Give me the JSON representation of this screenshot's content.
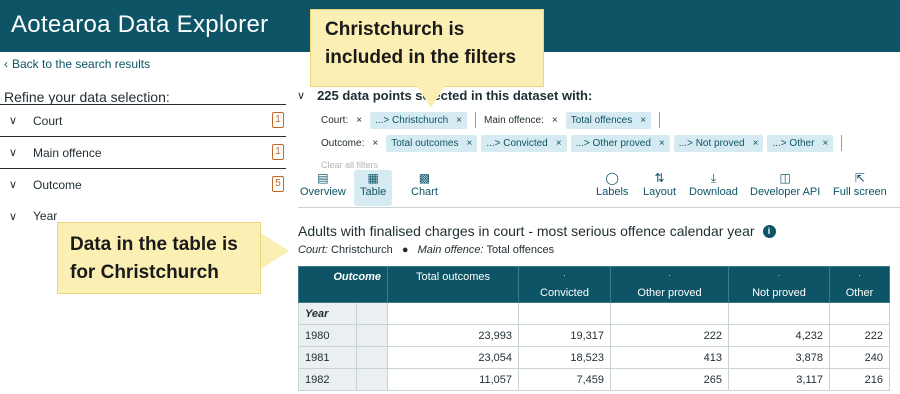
{
  "app": {
    "title": "Aotearoa Data Explorer"
  },
  "nav": {
    "back_label": "Back to the search results"
  },
  "sidebar": {
    "title": "Refine your data selection:",
    "items": [
      {
        "label": "Court",
        "count": "1"
      },
      {
        "label": "Main offence",
        "count": "1"
      },
      {
        "label": "Outcome",
        "count": "5"
      },
      {
        "label": "Year",
        "count": ""
      }
    ]
  },
  "selection": {
    "summary": "225 data points selected in this dataset with:",
    "court_label": "Court:",
    "court_chips": [
      "...> Christchurch"
    ],
    "offence_label": "Main offence:",
    "offence_chips": [
      "Total offences"
    ],
    "outcome_label": "Outcome:",
    "outcome_chips": [
      "Total outcomes",
      "...> Convicted",
      "...> Other proved",
      "...> Not proved",
      "...> Other"
    ],
    "remove_symbol": "×",
    "clear_all": "Clear all filters"
  },
  "toolbar": {
    "overview": "Overview",
    "table": "Table",
    "chart": "Chart",
    "labels": "Labels",
    "layout": "Layout",
    "download": "Download",
    "developer_api": "Developer API",
    "full_screen": "Full screen"
  },
  "table": {
    "title": "Adults with finalised charges in court - most serious offence calendar year",
    "sub_court_label": "Court:",
    "sub_court_value": "Christchurch",
    "sub_offence_label": "Main offence:",
    "sub_offence_value": "Total offences",
    "corner_label": "Outcome",
    "row_dim_label": "Year",
    "columns": [
      "Total outcomes",
      "Convicted",
      "Other proved",
      "Not proved",
      "Other"
    ],
    "level_marker": "·",
    "rows": [
      {
        "year": "1980",
        "values": [
          "23,993",
          "19,317",
          "222",
          "4,232",
          "222"
        ]
      },
      {
        "year": "1981",
        "values": [
          "23,054",
          "18,523",
          "413",
          "3,878",
          "240"
        ]
      },
      {
        "year": "1982",
        "values": [
          "11,057",
          "7,459",
          "265",
          "3,117",
          "216"
        ]
      }
    ]
  },
  "callouts": {
    "filters": "Christchurch is included in the filters",
    "table": "Data in the table is for Christchurch"
  },
  "colors": {
    "brand": "#0d5566",
    "chip_bg": "#d6eaf2",
    "badge": "#c0652a",
    "callout_bg": "#fbefb3"
  }
}
